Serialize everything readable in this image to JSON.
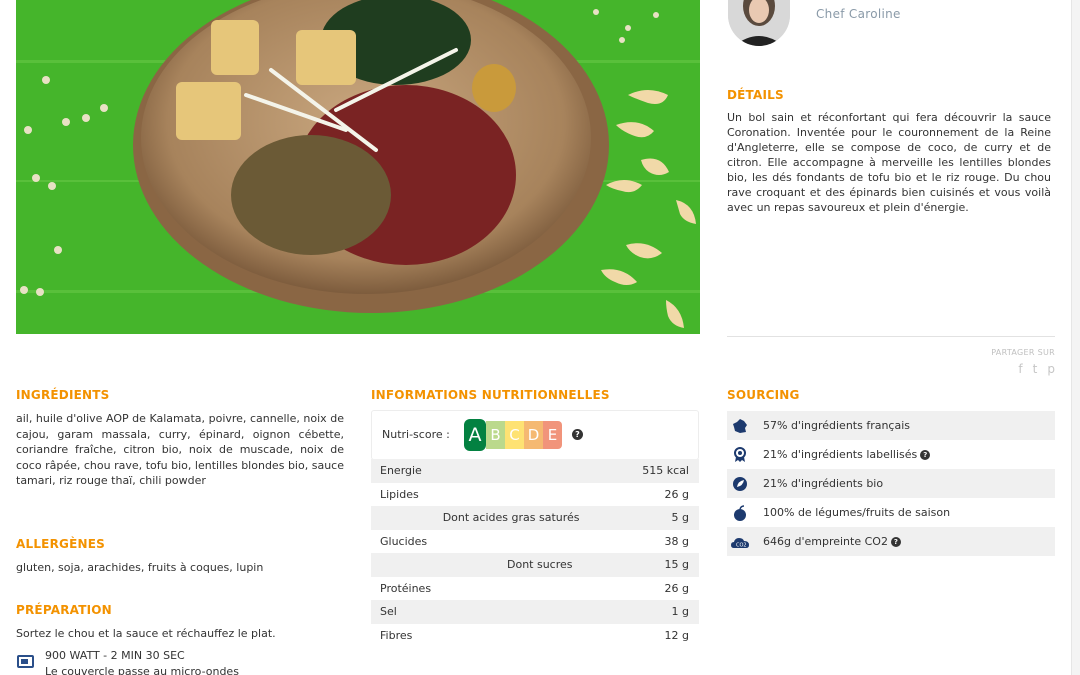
{
  "chef": {
    "name": "Chef Caroline"
  },
  "details": {
    "title": "DÉTAILS",
    "text": "Un bol sain et réconfortant qui fera découvrir la sauce Coronation. Inventée pour le couronnement de la Reine d'Angleterre, elle se compose de coco, de curry et de citron. Elle accompagne à merveille les lentilles blondes bio, les dés fondants de tofu bio et le riz rouge. Du chou rave croquant et des épinards bien cuisinés et vous voilà avec un repas savoureux et plein d'énergie."
  },
  "share": {
    "label": "PARTAGER SUR",
    "icons": [
      "facebook-icon",
      "twitter-icon",
      "pinterest-icon"
    ],
    "glyphs": [
      "f",
      "t",
      "p"
    ]
  },
  "ingredients": {
    "title": "INGRÉDIENTS",
    "text": "ail, huile d'olive AOP de Kalamata, poivre, cannelle, noix de cajou, garam massala, curry, épinard, oignon cébette, coriandre fraîche, citron bio, noix de muscade, noix de coco râpée, chou rave, tofu bio, lentilles blondes bio, sauce tamari, riz rouge thaï, chili powder"
  },
  "allergens": {
    "title": "ALLERGÈNES",
    "text": "gluten, soja, arachides, fruits à coques, lupin"
  },
  "preparation": {
    "title": "PRÉPARATION",
    "text": "Sortez le chou et la sauce et réchauffez le plat.",
    "microwave_power": "900 WATT - 2 MIN 30 SEC",
    "microwave_note": "Le couvercle passe au micro-ondes"
  },
  "nutrition": {
    "title": "INFORMATIONS NUTRITIONNELLES",
    "nutriscore_label": "Nutri-score :",
    "nutriscore": {
      "letters": [
        "A",
        "B",
        "C",
        "D",
        "E"
      ],
      "selected": "A",
      "colors": [
        "#038141",
        "#85bb2f",
        "#fecb02",
        "#ee8100",
        "#e63e11"
      ]
    },
    "rows": [
      {
        "label": "Energie",
        "value": "515 kcal",
        "sub": false
      },
      {
        "label": "Lipides",
        "value": "26 g",
        "sub": false
      },
      {
        "label": "Dont acides gras saturés",
        "value": "5 g",
        "sub": true
      },
      {
        "label": "Glucides",
        "value": "38 g",
        "sub": false
      },
      {
        "label": "Dont sucres",
        "value": "15 g",
        "sub": true
      },
      {
        "label": "Protéines",
        "value": "26 g",
        "sub": false
      },
      {
        "label": "Sel",
        "value": "1 g",
        "sub": false
      },
      {
        "label": "Fibres",
        "value": "12 g",
        "sub": false
      }
    ]
  },
  "sourcing": {
    "title": "SOURCING",
    "items": [
      {
        "text": "57% d'ingrédients français",
        "icon": "france-map-icon",
        "info": false
      },
      {
        "text": "21% d'ingrédients labellisés",
        "icon": "label-badge-icon",
        "info": true
      },
      {
        "text": "21% d'ingrédients bio",
        "icon": "organic-leaf-icon",
        "info": false
      },
      {
        "text": "100% de légumes/fruits de saison",
        "icon": "apple-icon",
        "info": false
      },
      {
        "text": "646g d'empreinte CO2",
        "icon": "co2-cloud-icon",
        "info": true
      }
    ]
  },
  "colors": {
    "accent": "#f39200",
    "icon_blue": "#1d3a6e",
    "photo_green": "#43b32a"
  }
}
